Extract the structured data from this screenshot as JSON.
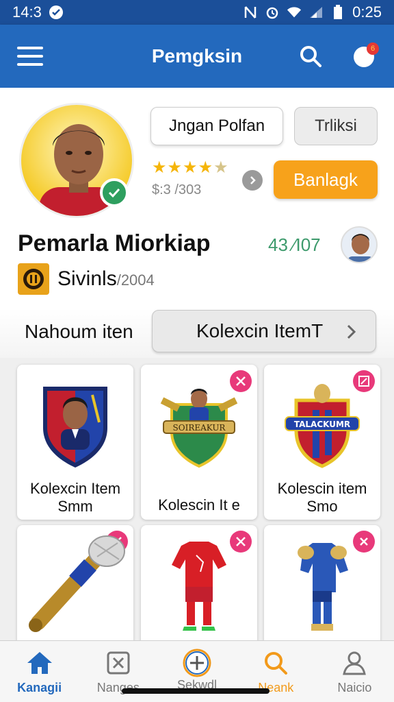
{
  "status_bar": {
    "time": "14:3",
    "clock": "0:25"
  },
  "app_bar": {
    "title": "Pemgksin",
    "notif_count": "6"
  },
  "profile": {
    "follow_label": "Jngan Polfan",
    "secondary_label": "Trliksi",
    "primary_label": "Banlagk",
    "rating_stars": "★★★★",
    "rating_half": "★",
    "price": "$:3 /303",
    "name": "Pemarla Miorkiap",
    "count": "43 ⁄I07",
    "club_name": "Sivinls",
    "club_year": "/2004"
  },
  "filter": {
    "label": "Nahoum iten",
    "select_value": "Kolexcin ItemT"
  },
  "cards": [
    {
      "label": "Kolexcin Item Smm",
      "badge": ""
    },
    {
      "label": "Kolescin It e",
      "badge": "swords",
      "emblem_text": "SOIREAKUR"
    },
    {
      "label": "Kolescin item Smo",
      "badge": "edit",
      "emblem_text": "TALACKUMR"
    },
    {
      "label": "",
      "badge": "swords"
    },
    {
      "label": "",
      "badge": "swords"
    },
    {
      "label": "",
      "badge": "close"
    }
  ],
  "bottom_nav": [
    {
      "label": "Kanagii"
    },
    {
      "label": "Nanges"
    },
    {
      "label": "Sekwdl"
    },
    {
      "label": "Neank"
    },
    {
      "label": "Naicio"
    }
  ],
  "colors": {
    "primary": "#2369bd",
    "accent": "#f7a21b",
    "success": "#2e9f5f",
    "badge": "#e8397a"
  }
}
